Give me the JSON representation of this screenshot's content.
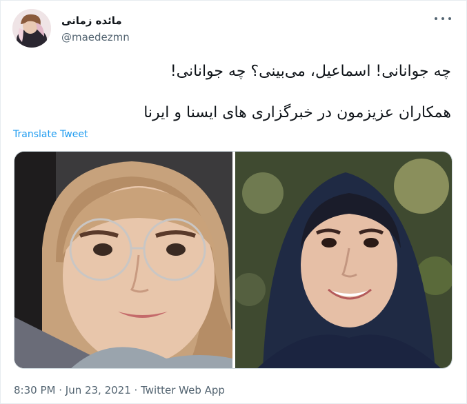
{
  "author": {
    "display_name": "مائده زمانی",
    "handle": "@maedezmn"
  },
  "tweet": {
    "line1": "چه جوانانی! اسماعیل، می‌بینی؟ چه جوانانی!",
    "line2": "همکاران عزیزمون در خبرگزاری های ایسنا و ایرنا",
    "translate_label": "Translate Tweet"
  },
  "meta": {
    "time": "8:30 PM",
    "sep1": " · ",
    "date": "Jun 23, 2021",
    "sep2": " · ",
    "app": "Twitter Web App"
  },
  "icons": {
    "more": "more-horizontal-icon"
  },
  "colors": {
    "link": "#1d9bf0",
    "muted": "#536471",
    "text": "#0f1419"
  }
}
